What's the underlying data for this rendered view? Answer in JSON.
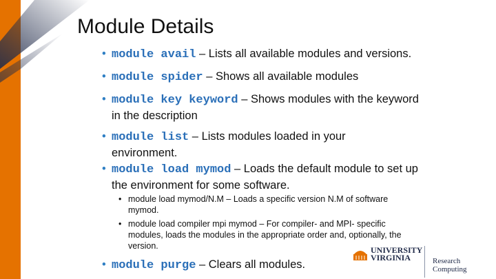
{
  "title": "Module Details",
  "items": [
    {
      "code": "module avail",
      "text": " – Lists all available modules and versions."
    },
    {
      "code": "module spider",
      "text": " – Shows all available modules"
    },
    {
      "code": "module key keyword",
      "text": " – Shows modules with the keyword in the description"
    },
    {
      "code": "module list",
      "text": " – Lists modules loaded in your environment."
    },
    {
      "code": "module load mymod",
      "text": " – Loads the default module to set up the environment for some software."
    },
    {
      "code": "module purge",
      "text": " – Clears all modules."
    }
  ],
  "subitems": [
    "module load mymod/N.M – Loads a specific version N.M of software mymod.",
    "module load compiler mpi mymod – For compiler- and MPI- specific modules, loads the modules in the appropriate order and, optionally, the version."
  ],
  "logo": {
    "line1": "UNIVERSITY",
    "line2": "VIRGINIA",
    "dept": "Research Computing"
  },
  "colors": {
    "orange": "#e57200",
    "navy": "#232d4b",
    "code": "#2a6fb8"
  }
}
